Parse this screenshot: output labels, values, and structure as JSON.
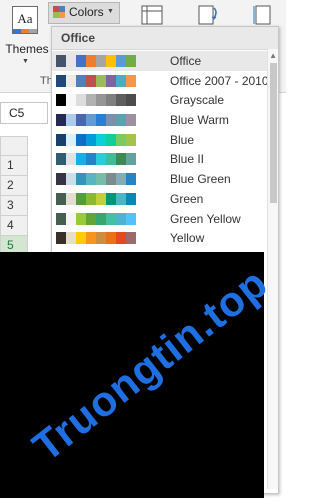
{
  "ribbon": {
    "themes_label": "Themes",
    "themes_icon_text": "Aa",
    "colors_label": "Colors",
    "group_label": "Th"
  },
  "namebox": {
    "value": "C5"
  },
  "rows": [
    "1",
    "2",
    "3",
    "4",
    "5"
  ],
  "menu": {
    "header": "Office",
    "items": [
      {
        "label": "Office",
        "colors": [
          "#44546a",
          "#e7e6e6",
          "#4472c4",
          "#ed7d31",
          "#a5a5a5",
          "#ffc000",
          "#5b9bd5",
          "#70ad47"
        ]
      },
      {
        "label": "Office 2007 - 2010",
        "colors": [
          "#1f497d",
          "#eeece1",
          "#4f81bd",
          "#c0504d",
          "#9bbb59",
          "#8064a2",
          "#4bacc6",
          "#f79646"
        ]
      },
      {
        "label": "Grayscale",
        "colors": [
          "#000000",
          "#f8f8f8",
          "#dddddd",
          "#b2b2b2",
          "#969696",
          "#808080",
          "#5f5f5f",
          "#4d4d4d"
        ]
      },
      {
        "label": "Blue Warm",
        "colors": [
          "#242852",
          "#acccea",
          "#4a66ac",
          "#629dd1",
          "#297fd5",
          "#7f8fa9",
          "#5aa2ae",
          "#9d90a0"
        ]
      },
      {
        "label": "Blue",
        "colors": [
          "#17406d",
          "#dbeff9",
          "#0f6fc6",
          "#009dd9",
          "#0bd0d9",
          "#10cf9b",
          "#7cca62",
          "#a5c249"
        ]
      },
      {
        "label": "Blue II",
        "colors": [
          "#335b74",
          "#dfe3e5",
          "#1cade4",
          "#2683c6",
          "#27ced7",
          "#42ba97",
          "#3e8853",
          "#62a39f"
        ]
      },
      {
        "label": "Blue Green",
        "colors": [
          "#373545",
          "#ceddea",
          "#3494ba",
          "#58b6c0",
          "#75bda7",
          "#7a8c8e",
          "#84acb6",
          "#2683c6"
        ]
      },
      {
        "label": "Green",
        "colors": [
          "#455f51",
          "#e3ded1",
          "#549e39",
          "#8ab833",
          "#c0cf3a",
          "#029676",
          "#4ab5c4",
          "#0989b1"
        ]
      },
      {
        "label": "Green Yellow",
        "colors": [
          "#455f51",
          "#f5f5f5",
          "#99cb38",
          "#63a537",
          "#37a76f",
          "#44c1a3",
          "#4eb3cf",
          "#51c3f9"
        ]
      },
      {
        "label": "Yellow",
        "colors": [
          "#39302a",
          "#e5dec9",
          "#ffca08",
          "#f8931d",
          "#ce8d3e",
          "#ec7016",
          "#e64823",
          "#9c6a6a"
        ]
      }
    ]
  },
  "watermark": "Truongtin.top",
  "colors": {
    "ribbon_bg": "#f3f3f3",
    "selection_green": "#217346",
    "watermark_blue": "#1f6fe2"
  }
}
